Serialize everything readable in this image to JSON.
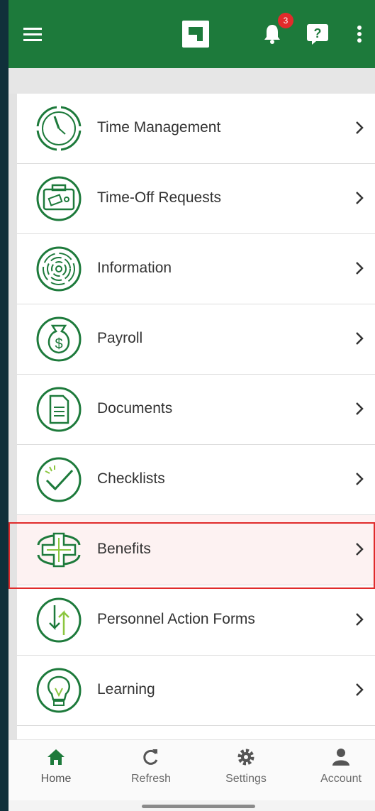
{
  "theme": {
    "brand_green": "#1d7a3b",
    "badge_red": "#e22b2b",
    "highlight_red": "#e02b2b"
  },
  "topbar": {
    "menu_icon": "hamburger-icon",
    "logo_icon": "paylocity-logo-icon",
    "bell_icon": "bell-icon",
    "notification_count": "3",
    "help_icon": "help-icon",
    "more_icon": "more-vertical-icon"
  },
  "menu": {
    "items": [
      {
        "label": "Time Management",
        "icon": "clock-icon"
      },
      {
        "label": "Time-Off Requests",
        "icon": "suitcase-icon"
      },
      {
        "label": "Information",
        "icon": "fingerprint-icon"
      },
      {
        "label": "Payroll",
        "icon": "money-bag-icon"
      },
      {
        "label": "Documents",
        "icon": "document-icon"
      },
      {
        "label": "Checklists",
        "icon": "checkmark-icon"
      },
      {
        "label": "Benefits",
        "icon": "medical-cross-icon",
        "selected": true
      },
      {
        "label": "Personnel Action Forms",
        "icon": "up-down-arrows-icon"
      },
      {
        "label": "Learning",
        "icon": "lightbulb-icon"
      }
    ]
  },
  "bottom_nav": {
    "home": "Home",
    "refresh": "Refresh",
    "settings": "Settings",
    "account": "Account"
  }
}
